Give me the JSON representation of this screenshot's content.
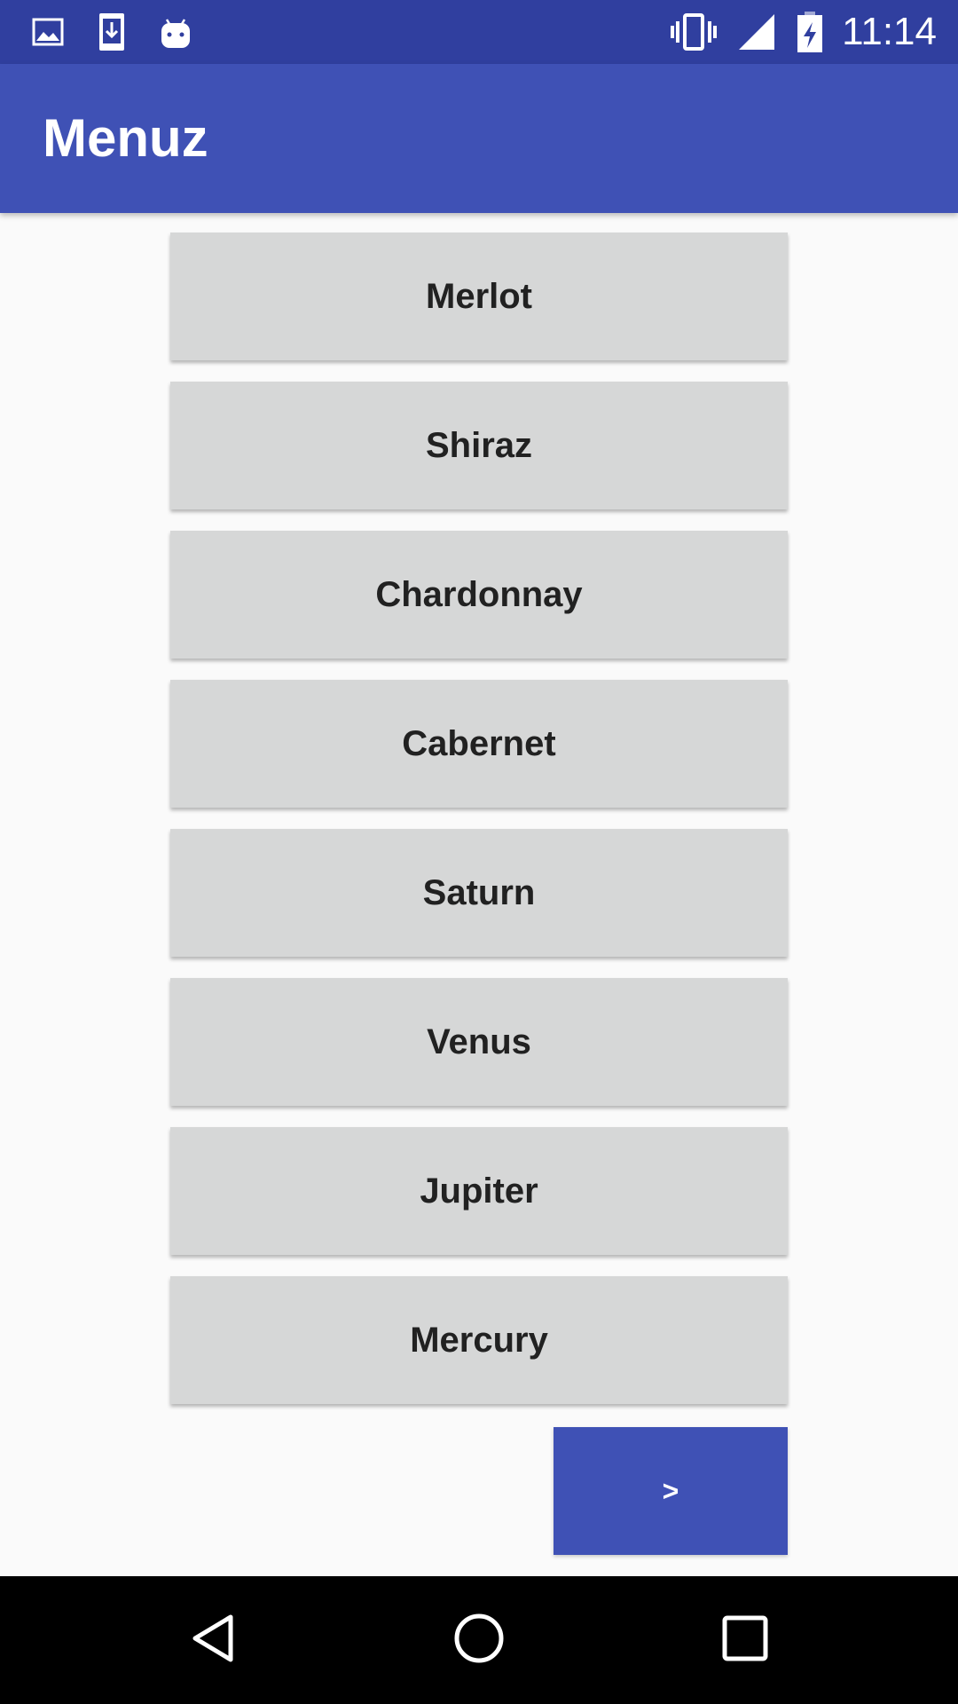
{
  "status_bar": {
    "time": "11:14",
    "left_icons": [
      "image-icon",
      "download-icon",
      "android-icon"
    ],
    "right_icons": [
      "vibrate-icon",
      "signal-icon",
      "battery-charging-icon"
    ]
  },
  "app_bar": {
    "title": "Menuz"
  },
  "menu": {
    "items": [
      {
        "label": "Merlot"
      },
      {
        "label": "Shiraz"
      },
      {
        "label": "Chardonnay"
      },
      {
        "label": "Cabernet"
      },
      {
        "label": "Saturn"
      },
      {
        "label": "Venus"
      },
      {
        "label": "Jupiter"
      },
      {
        "label": "Mercury"
      }
    ]
  },
  "next_button": {
    "label": ">"
  },
  "nav_bar": {
    "icons": [
      "back-icon",
      "home-icon",
      "recents-icon"
    ]
  },
  "colors": {
    "status_bar": "#303f9f",
    "app_bar": "#3f51b5",
    "button_bg": "#d6d7d7",
    "background": "#fafafa"
  }
}
